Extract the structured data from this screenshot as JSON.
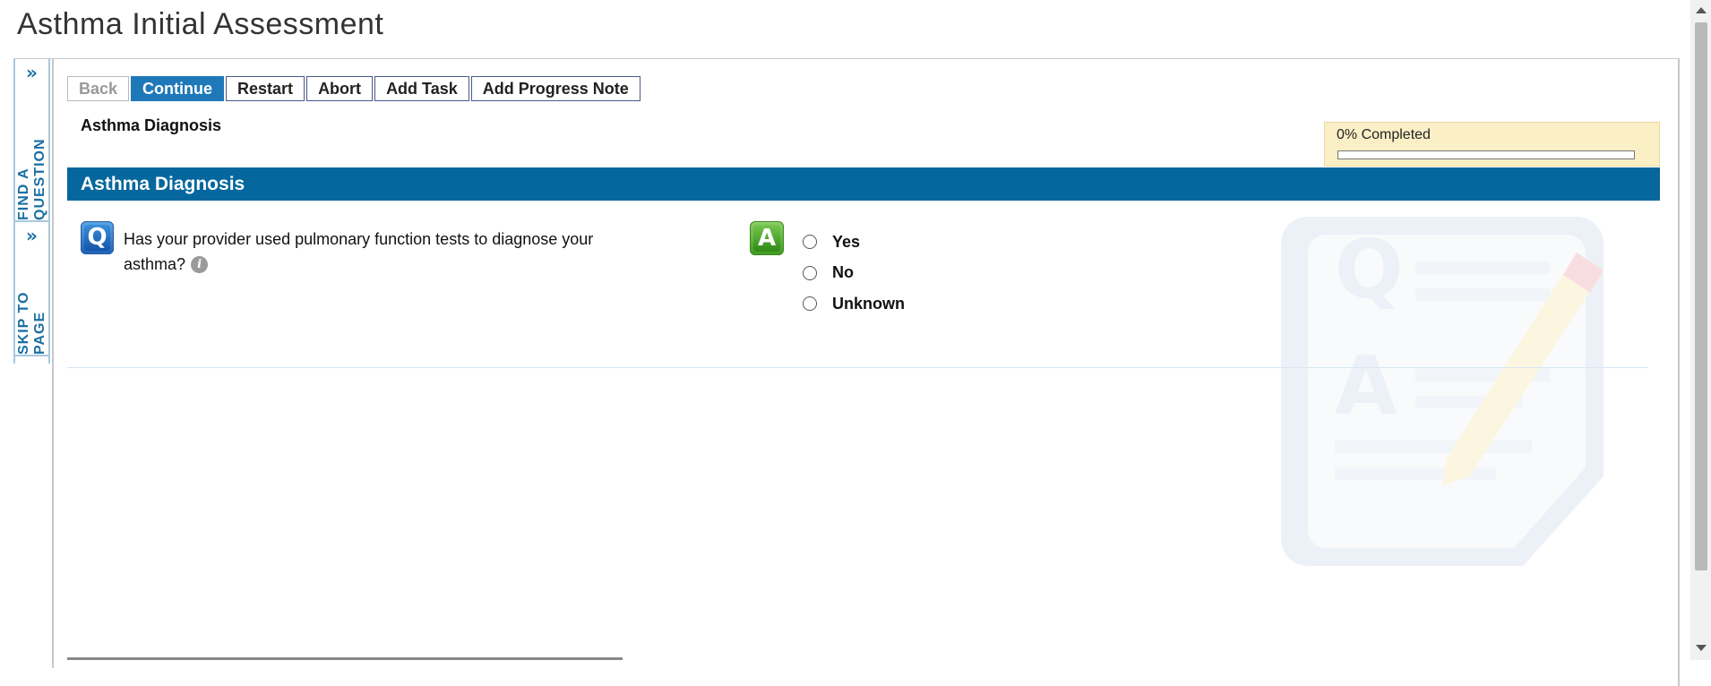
{
  "page": {
    "title": "Asthma Initial Assessment"
  },
  "side_rail": {
    "find_question": {
      "label": "FIND A QUESTION",
      "icon": "double-chevron-right-icon"
    },
    "skip_to_page": {
      "label": "SKIP TO PAGE",
      "icon": "double-chevron-right-icon"
    }
  },
  "toolbar": {
    "back_label": "Back",
    "continue_label": "Continue",
    "restart_label": "Restart",
    "abort_label": "Abort",
    "add_task_label": "Add Task",
    "add_progress_note_label": "Add Progress Note"
  },
  "breadcrumb": {
    "section": "Asthma Diagnosis"
  },
  "progress": {
    "label": "0% Completed",
    "fraction": 0
  },
  "section": {
    "title": "Asthma Diagnosis"
  },
  "question": {
    "icon_letter": "Q",
    "text": "Has your provider used pulmonary function tests to diagnose your asthma?",
    "info_glyph": "i"
  },
  "answer": {
    "icon_letter": "A",
    "options": [
      {
        "label": "Yes",
        "selected": false
      },
      {
        "label": "No",
        "selected": false
      },
      {
        "label": "Unknown",
        "selected": false
      }
    ]
  },
  "colors": {
    "section_header_bg": "#05679d",
    "continue_bg": "#1f78b8",
    "progress_bg": "#fbefc6",
    "rail_text": "#1a6fa3"
  }
}
